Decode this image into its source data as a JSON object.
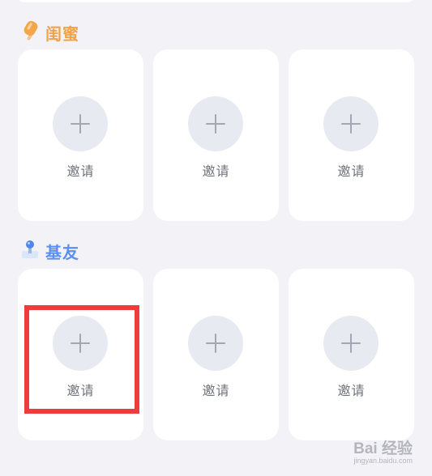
{
  "sections": [
    {
      "title": "闺蜜",
      "icon": "popsicle-icon",
      "color": "#f0a24b",
      "slots": [
        {
          "label": "邀请"
        },
        {
          "label": "邀请"
        },
        {
          "label": "邀请"
        }
      ]
    },
    {
      "title": "基友",
      "icon": "joystick-icon",
      "color": "#5b8ff0",
      "slots": [
        {
          "label": "邀请"
        },
        {
          "label": "邀请"
        },
        {
          "label": "邀请"
        }
      ]
    }
  ],
  "watermark": {
    "brand": "Bai 经验",
    "url": "jingyan.baidu.com"
  },
  "colors": {
    "background": "#f3f3f7",
    "card": "#ffffff",
    "plus_circle": "#e8eaf1",
    "highlight": "#ef3b3b"
  }
}
